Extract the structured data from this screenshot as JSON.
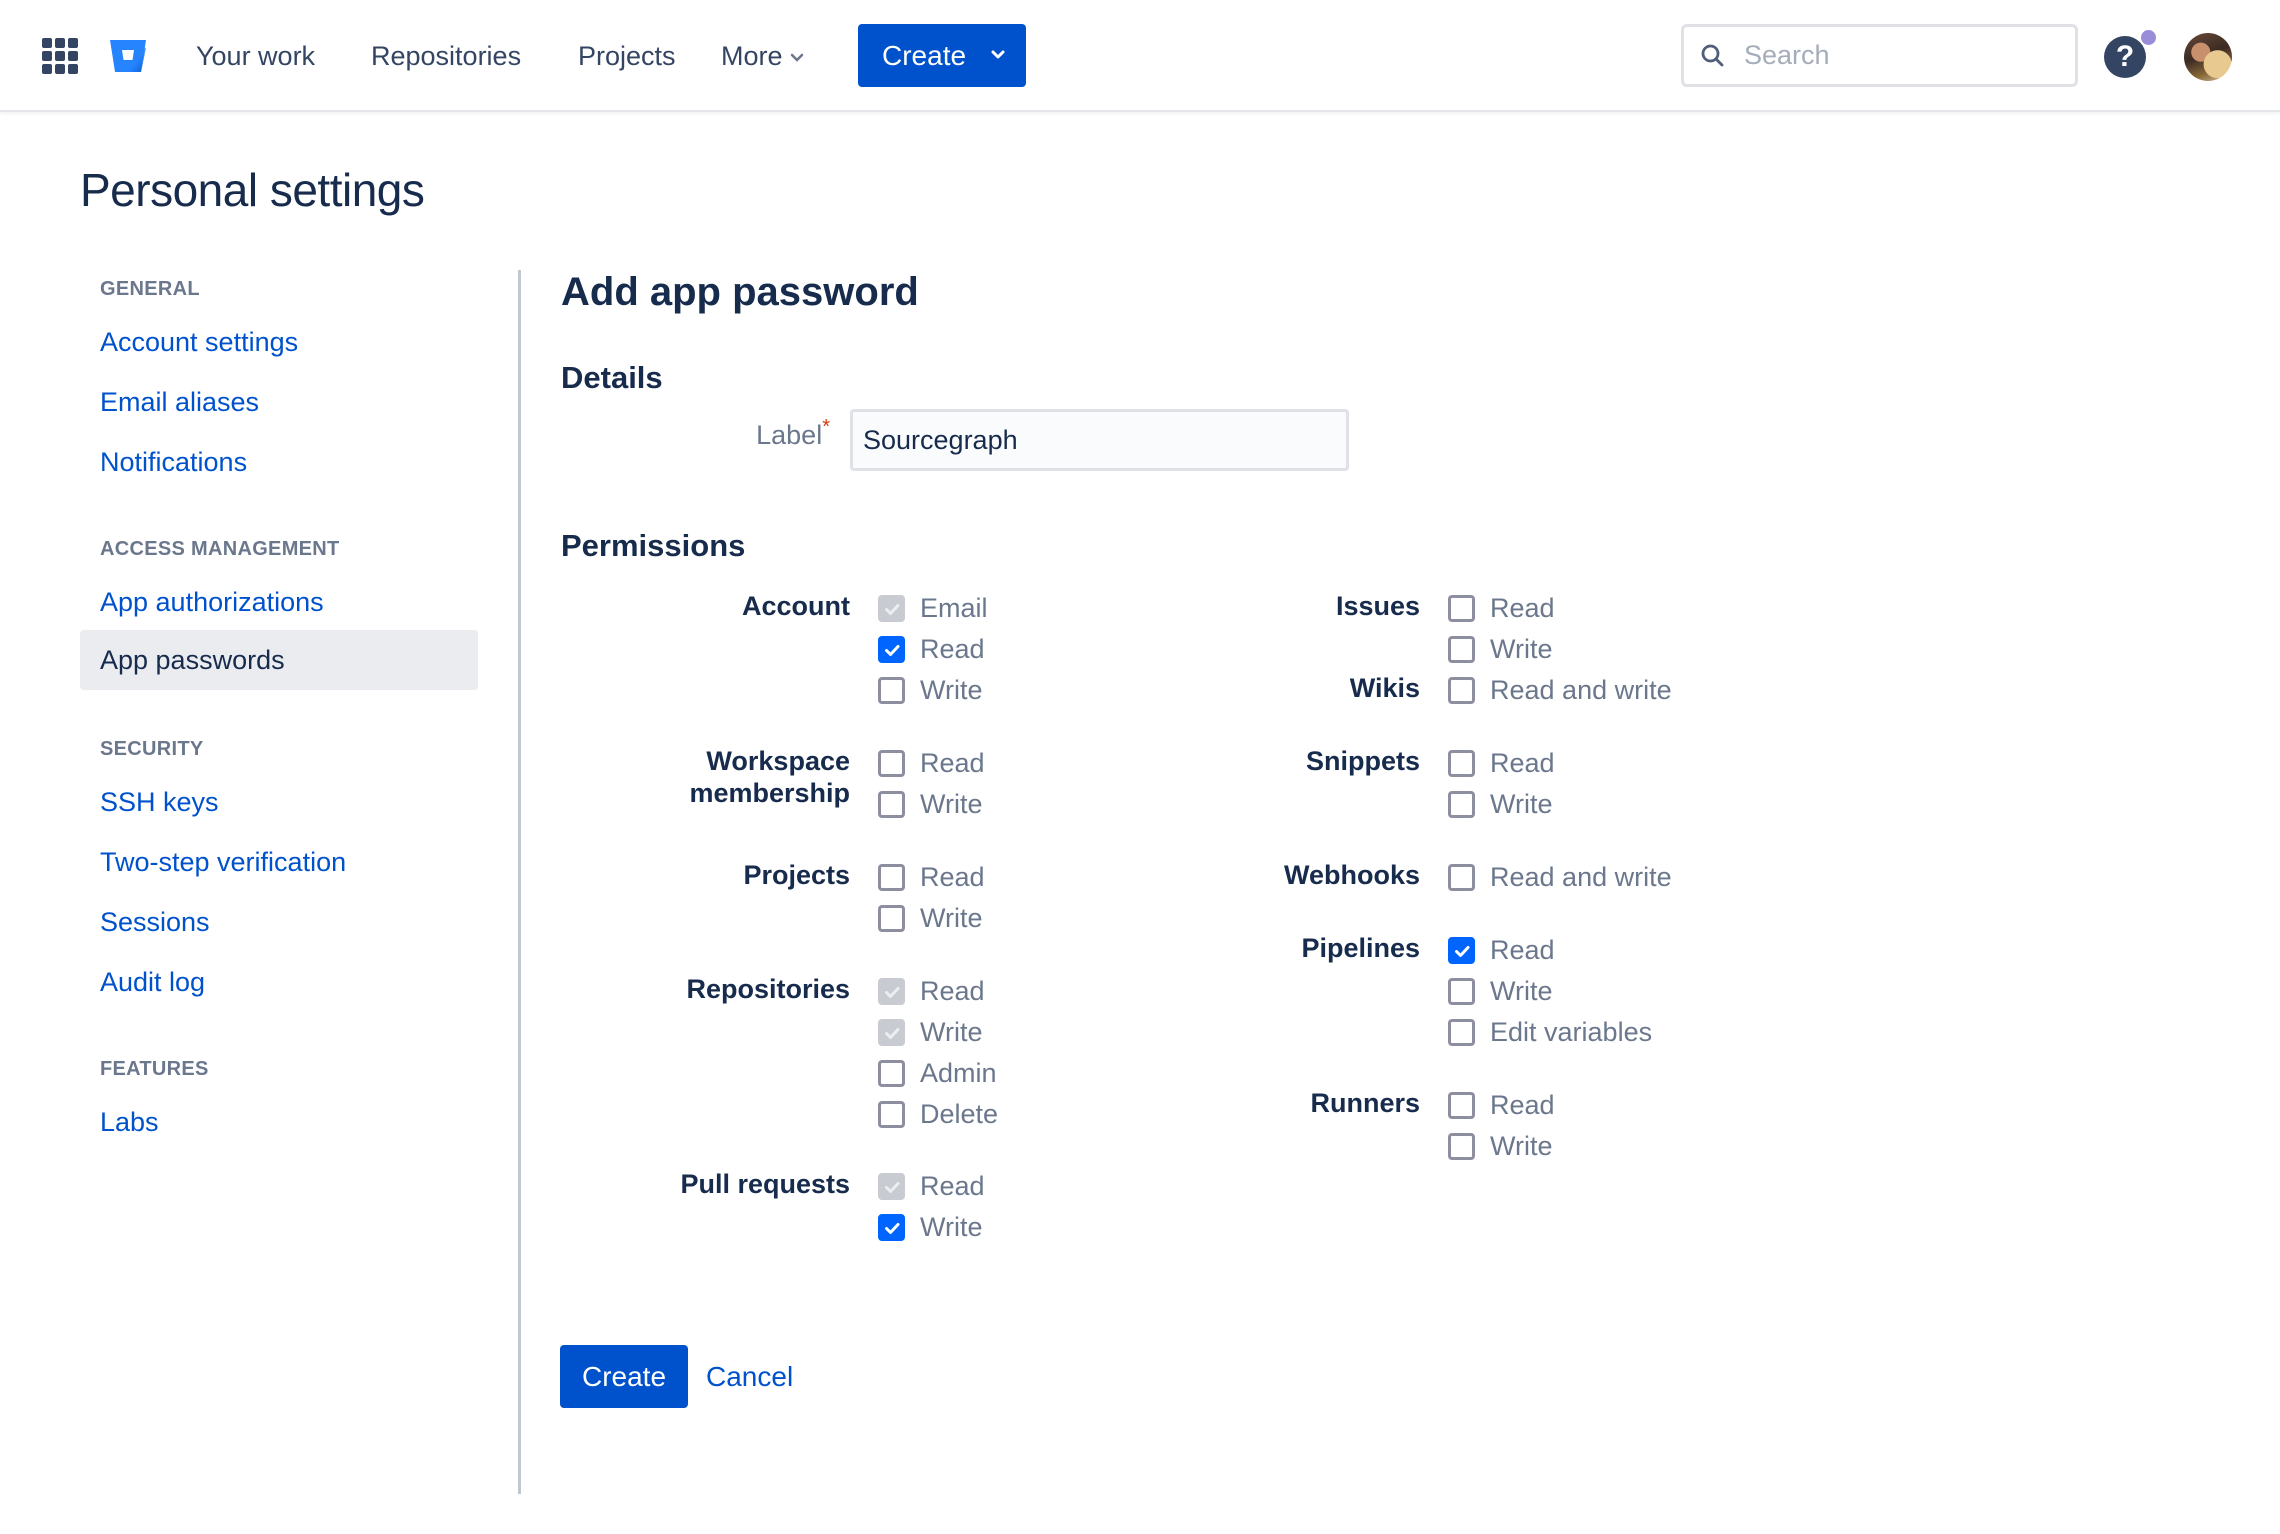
{
  "header": {
    "nav": [
      "Your work",
      "Repositories",
      "Projects",
      "More"
    ],
    "create_label": "Create",
    "search_placeholder": "Search",
    "help_label": "?",
    "colors": {
      "primary": "#0052cc",
      "logo": "#2684ff",
      "notification_dot": "#998dd9"
    }
  },
  "page": {
    "title": "Personal settings"
  },
  "sidebar": {
    "sections": [
      {
        "title": "GENERAL",
        "items": [
          {
            "label": "Account settings",
            "active": false
          },
          {
            "label": "Email aliases",
            "active": false
          },
          {
            "label": "Notifications",
            "active": false
          }
        ]
      },
      {
        "title": "ACCESS MANAGEMENT",
        "items": [
          {
            "label": "App authorizations",
            "active": false
          },
          {
            "label": "App passwords",
            "active": true
          }
        ]
      },
      {
        "title": "SECURITY",
        "items": [
          {
            "label": "SSH keys",
            "active": false
          },
          {
            "label": "Two-step verification",
            "active": false
          },
          {
            "label": "Sessions",
            "active": false
          },
          {
            "label": "Audit log",
            "active": false
          }
        ]
      },
      {
        "title": "FEATURES",
        "items": [
          {
            "label": "Labs",
            "active": false
          }
        ]
      }
    ]
  },
  "form": {
    "title": "Add app password",
    "details_heading": "Details",
    "label_field": {
      "label": "Label",
      "required_marker": "*",
      "value": "Sourcegraph"
    },
    "permissions_heading": "Permissions",
    "left_groups": [
      {
        "name": "Account",
        "options": [
          {
            "label": "Email",
            "checked": true,
            "disabled": true
          },
          {
            "label": "Read",
            "checked": true,
            "disabled": false
          },
          {
            "label": "Write",
            "checked": false,
            "disabled": false
          }
        ]
      },
      {
        "name": "Workspace membership",
        "name_lines": [
          "Workspace",
          "membership"
        ],
        "options": [
          {
            "label": "Read",
            "checked": false,
            "disabled": false
          },
          {
            "label": "Write",
            "checked": false,
            "disabled": false
          }
        ]
      },
      {
        "name": "Projects",
        "options": [
          {
            "label": "Read",
            "checked": false,
            "disabled": false
          },
          {
            "label": "Write",
            "checked": false,
            "disabled": false
          }
        ]
      },
      {
        "name": "Repositories",
        "options": [
          {
            "label": "Read",
            "checked": true,
            "disabled": true
          },
          {
            "label": "Write",
            "checked": true,
            "disabled": true
          },
          {
            "label": "Admin",
            "checked": false,
            "disabled": false
          },
          {
            "label": "Delete",
            "checked": false,
            "disabled": false
          }
        ]
      },
      {
        "name": "Pull requests",
        "options": [
          {
            "label": "Read",
            "checked": true,
            "disabled": true
          },
          {
            "label": "Write",
            "checked": true,
            "disabled": false
          }
        ]
      }
    ],
    "right_groups": [
      {
        "name": "Issues",
        "options": [
          {
            "label": "Read",
            "checked": false,
            "disabled": false
          },
          {
            "label": "Write",
            "checked": false,
            "disabled": false
          }
        ]
      },
      {
        "name": "Wikis",
        "options": [
          {
            "label": "Read and write",
            "checked": false,
            "disabled": false
          }
        ]
      },
      {
        "name": "Snippets",
        "options": [
          {
            "label": "Read",
            "checked": false,
            "disabled": false
          },
          {
            "label": "Write",
            "checked": false,
            "disabled": false
          }
        ]
      },
      {
        "name": "Webhooks",
        "options": [
          {
            "label": "Read and write",
            "checked": false,
            "disabled": false
          }
        ]
      },
      {
        "name": "Pipelines",
        "options": [
          {
            "label": "Read",
            "checked": true,
            "disabled": false
          },
          {
            "label": "Write",
            "checked": false,
            "disabled": false
          },
          {
            "label": "Edit variables",
            "checked": false,
            "disabled": false
          }
        ]
      },
      {
        "name": "Runners",
        "options": [
          {
            "label": "Read",
            "checked": false,
            "disabled": false
          },
          {
            "label": "Write",
            "checked": false,
            "disabled": false
          }
        ]
      }
    ],
    "submit_label": "Create",
    "cancel_label": "Cancel"
  }
}
